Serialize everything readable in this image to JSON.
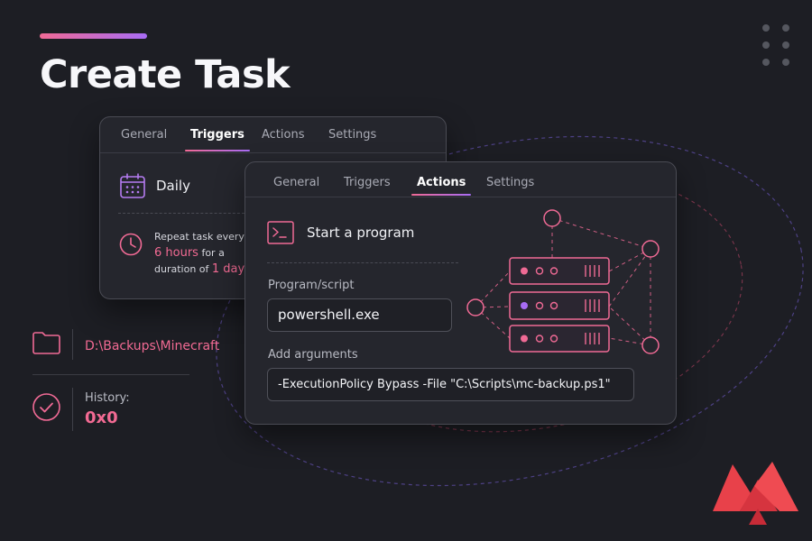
{
  "page": {
    "title": "Create Task"
  },
  "colors": {
    "background": "#1d1e24",
    "accent_pink": "#f26a93",
    "accent_purple": "#a86cf5",
    "panel": "#25262d",
    "brand_red": "#e8414a"
  },
  "triggers_window": {
    "tabs": [
      {
        "label": "General",
        "active": false
      },
      {
        "label": "Triggers",
        "active": true
      },
      {
        "label": "Actions",
        "active": false
      },
      {
        "label": "Settings",
        "active": false
      }
    ],
    "schedule_icon": "calendar-icon",
    "schedule": "Daily",
    "repeat_icon": "clock-icon",
    "repeat": {
      "prefix": "Repeat task every",
      "interval": "6 hours",
      "middle": "for a",
      "middle2": "duration of",
      "duration": "1 day"
    }
  },
  "actions_window": {
    "tabs": [
      {
        "label": "General",
        "active": false
      },
      {
        "label": "Triggers",
        "active": false
      },
      {
        "label": "Actions",
        "active": true
      },
      {
        "label": "Settings",
        "active": false
      }
    ],
    "action_icon": "terminal-icon",
    "action": "Start a program",
    "program_label": "Program/script",
    "program_value": "powershell.exe",
    "arguments_label": "Add arguments",
    "arguments_value": "-ExecutionPolicy Bypass -File \"C:\\Scripts\\mc-backup.ps1\"",
    "graphic_icon": "server-network-icon"
  },
  "info": {
    "folder_icon": "folder-icon",
    "folder_path": "D:\\Backups\\Minecraft",
    "history_icon": "check-circle-icon",
    "history_label": "History:",
    "history_value": "0x0"
  },
  "brand": {
    "logo_icon": "brand-logo-icon"
  }
}
